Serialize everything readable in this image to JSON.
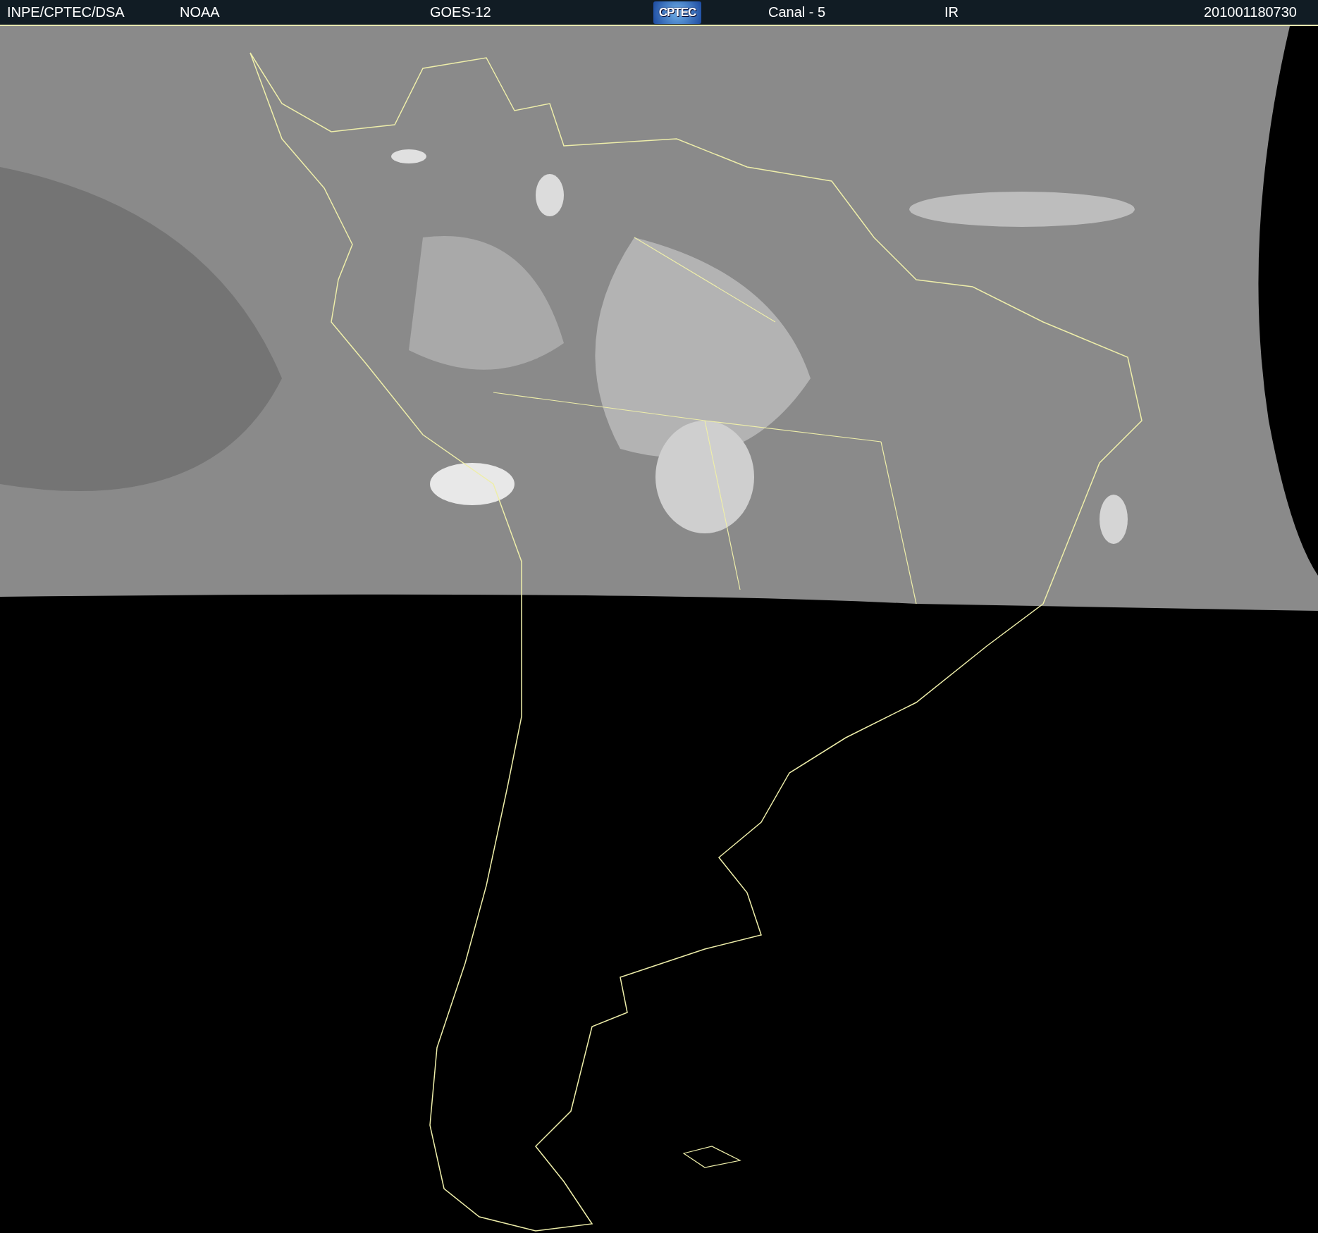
{
  "header": {
    "items": [
      {
        "kind": "text",
        "text": "INPE/CPTEC/DSA"
      },
      {
        "kind": "text",
        "text": "NOAA"
      },
      {
        "kind": "text",
        "text": "GOES-12"
      },
      {
        "kind": "logo",
        "text": "CPTEC"
      },
      {
        "kind": "text",
        "text": "Canal - 5"
      },
      {
        "kind": "text",
        "text": "IR"
      },
      {
        "kind": "text",
        "text": "201001180730"
      }
    ]
  }
}
